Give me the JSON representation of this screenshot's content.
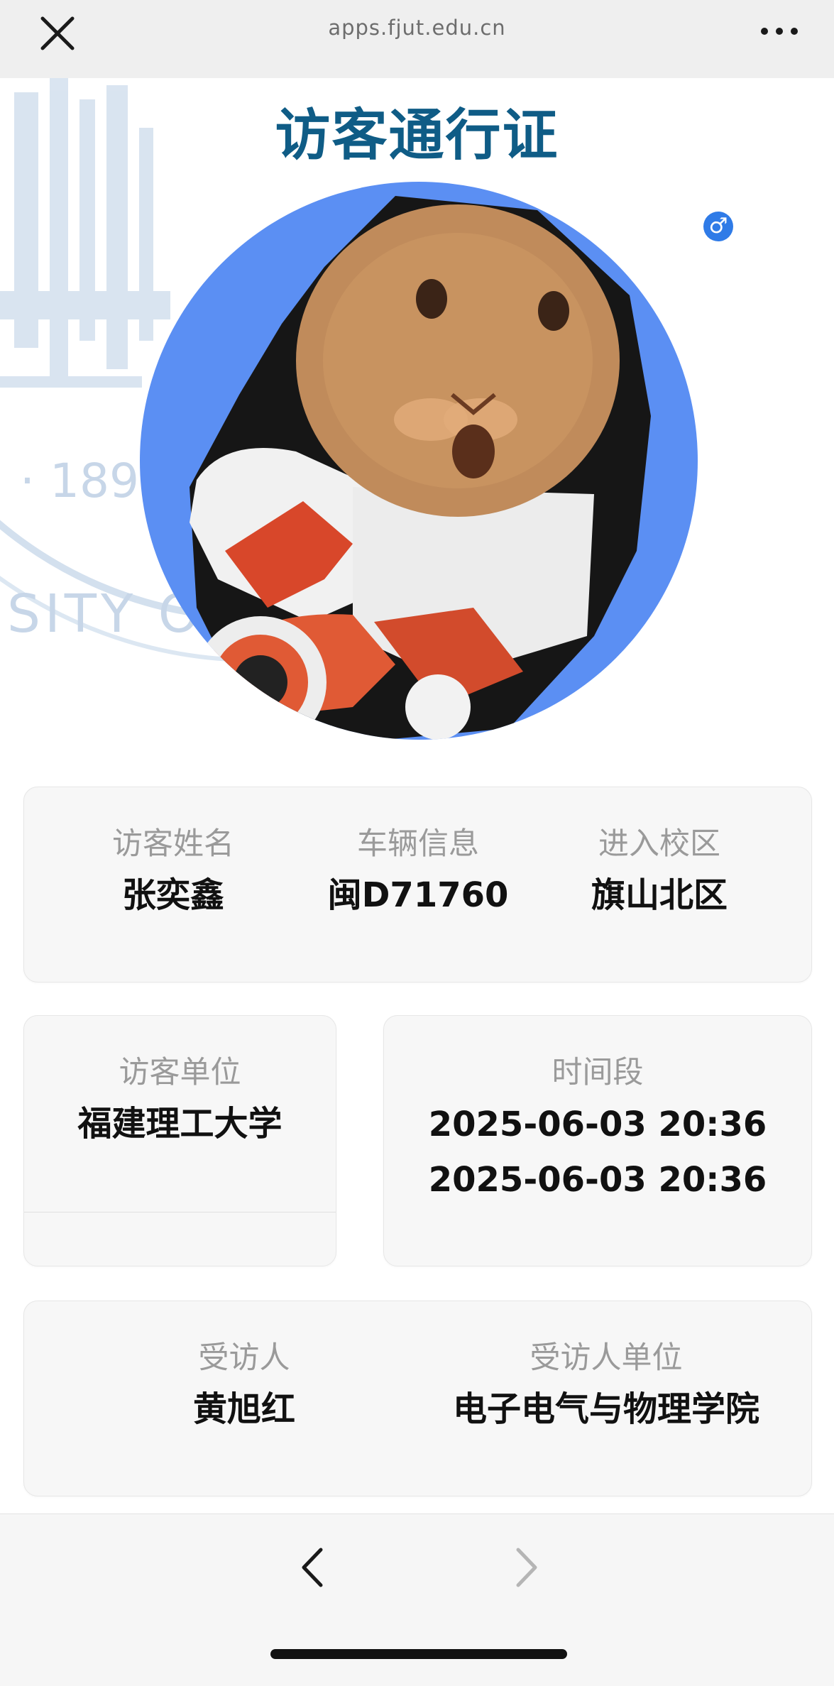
{
  "browser": {
    "url": "apps.fjut.edu.cn",
    "close_icon": "close-icon",
    "more_icon": "more-dots-icon"
  },
  "watermark": {
    "year_text": "· 1896",
    "ring_text": "SITY O"
  },
  "pass": {
    "title": "访客通行证",
    "gender_symbol": "♂",
    "avatar_icon": "visitor-avatar-photo"
  },
  "card1": {
    "name_label": "访客姓名",
    "name_value": "张奕鑫",
    "vehicle_label": "车辆信息",
    "vehicle_value": "闽D71760",
    "campus_label": "进入校区",
    "campus_value": "旗山北区"
  },
  "card2": {
    "unit_label": "访客单位",
    "unit_value": "福建理工大学"
  },
  "card3": {
    "time_label": "时间段",
    "time_start": "2025-06-03 20:36",
    "time_end": "2025-06-03 20:36"
  },
  "card4": {
    "host_label": "受访人",
    "host_value": "黄旭红",
    "host_unit_label": "受访人单位",
    "host_unit_value": "电子电气与物理学院"
  },
  "nav": {
    "back_icon": "chevron-left-icon",
    "forward_icon": "chevron-right-icon"
  },
  "colors": {
    "title": "#0f5c86",
    "avatar_bg": "#5b8ff3",
    "gender_badge": "#2f7be7",
    "watermark": "#c9d9ea"
  }
}
